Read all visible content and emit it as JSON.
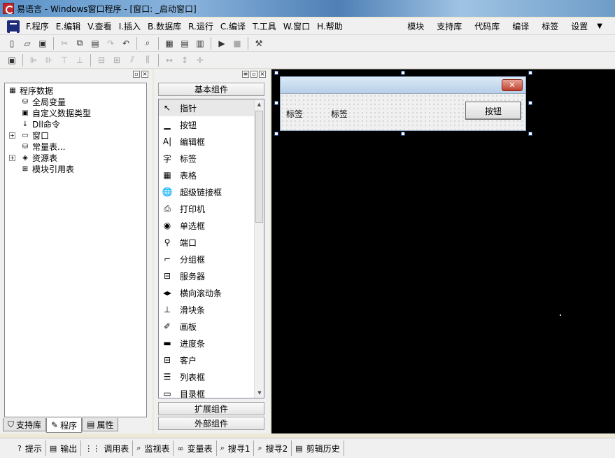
{
  "window": {
    "title": "易语言 - Windows窗口程序 - [窗口: _启动窗口]"
  },
  "menu": {
    "items": [
      "F.程序",
      "E.编辑",
      "V.查看",
      "I.插入",
      "B.数据库",
      "R.运行",
      "C.编译",
      "T.工具",
      "W.窗口",
      "H.帮助"
    ],
    "right_items": [
      "模块",
      "支持库",
      "代码库",
      "编译",
      "标签",
      "设置"
    ],
    "dropdown_glyph": "▼"
  },
  "tree": {
    "root": "程序数据",
    "nodes": [
      {
        "label": "全局变量",
        "icon": "database-icon",
        "glyph": "⛁",
        "expandable": false
      },
      {
        "label": "自定义数据类型",
        "icon": "datatype-icon",
        "glyph": "▣",
        "expandable": false
      },
      {
        "label": "Dll命令",
        "icon": "dll-icon",
        "glyph": "↓",
        "expandable": false
      },
      {
        "label": "窗口",
        "icon": "window-icon",
        "glyph": "▭",
        "expandable": true
      },
      {
        "label": "常量表...",
        "icon": "constant-icon",
        "glyph": "⛁",
        "expandable": false
      },
      {
        "label": "资源表",
        "icon": "resource-icon",
        "glyph": "◈",
        "expandable": true
      },
      {
        "label": "模块引用表",
        "icon": "module-icon",
        "glyph": "⊞",
        "expandable": false
      }
    ],
    "expand_glyph": "+"
  },
  "left_tabs": [
    {
      "label": "支持库",
      "icon": "library-icon",
      "glyph": "⛉"
    },
    {
      "label": "程序",
      "icon": "program-icon",
      "glyph": "✎"
    },
    {
      "label": "属性",
      "icon": "property-icon",
      "glyph": "▤"
    }
  ],
  "components": {
    "group_basic": "基本组件",
    "group_ext": "扩展组件",
    "group_external": "外部组件",
    "items": [
      {
        "label": "指针",
        "icon": "pointer-icon",
        "glyph": "↖"
      },
      {
        "label": "按钮",
        "icon": "button-icon",
        "glyph": "▁"
      },
      {
        "label": "编辑框",
        "icon": "editbox-icon",
        "glyph": "A|"
      },
      {
        "label": "标签",
        "icon": "label-icon",
        "glyph": "字"
      },
      {
        "label": "表格",
        "icon": "grid-icon",
        "glyph": "▦"
      },
      {
        "label": "超级链接框",
        "icon": "hyperlink-icon",
        "glyph": "🌐"
      },
      {
        "label": "打印机",
        "icon": "printer-icon",
        "glyph": "⎙"
      },
      {
        "label": "单选框",
        "icon": "radio-icon",
        "glyph": "◉"
      },
      {
        "label": "端口",
        "icon": "port-icon",
        "glyph": "⚲"
      },
      {
        "label": "分组框",
        "icon": "groupbox-icon",
        "glyph": "⌐"
      },
      {
        "label": "服务器",
        "icon": "server-icon",
        "glyph": "⊟"
      },
      {
        "label": "横向滚动条",
        "icon": "hscroll-icon",
        "glyph": "◂▸"
      },
      {
        "label": "滑块条",
        "icon": "slider-icon",
        "glyph": "⊥"
      },
      {
        "label": "画板",
        "icon": "canvas-icon",
        "glyph": "✐"
      },
      {
        "label": "进度条",
        "icon": "progressbar-icon",
        "glyph": "▬"
      },
      {
        "label": "客户",
        "icon": "client-icon",
        "glyph": "⊟"
      },
      {
        "label": "列表框",
        "icon": "listbox-icon",
        "glyph": "☰"
      },
      {
        "label": "目录框",
        "icon": "dirbox-icon",
        "glyph": "▭"
      }
    ]
  },
  "designer": {
    "label1": "标签",
    "label2": "标签",
    "button": "按钮",
    "close_glyph": "✕"
  },
  "bottom_tabs": [
    {
      "label": "提示",
      "icon": "hint-icon",
      "glyph": "?"
    },
    {
      "label": "输出",
      "icon": "output-icon",
      "glyph": "▤"
    },
    {
      "label": "调用表",
      "icon": "calltable-icon",
      "glyph": "⋮⋮"
    },
    {
      "label": "监视表",
      "icon": "watch-icon",
      "glyph": "⌕"
    },
    {
      "label": "变量表",
      "icon": "variable-icon",
      "glyph": "∞"
    },
    {
      "label": "搜寻1",
      "icon": "search-icon",
      "glyph": "⌕"
    },
    {
      "label": "搜寻2",
      "icon": "search-icon",
      "glyph": "⌕"
    },
    {
      "label": "剪辑历史",
      "icon": "clipboard-icon",
      "glyph": "▤"
    }
  ]
}
